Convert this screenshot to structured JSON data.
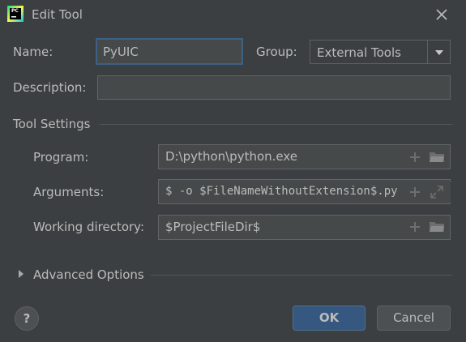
{
  "window": {
    "title": "Edit Tool",
    "logo_text": "PC"
  },
  "form": {
    "name_label": "Name:",
    "name_value": "PyUIC",
    "group_label": "Group:",
    "group_value": "External Tools",
    "description_label": "Description:",
    "description_value": ""
  },
  "tool_settings": {
    "section_label": "Tool Settings",
    "program_label": "Program:",
    "program_value": "D:\\python\\python.exe",
    "arguments_label": "Arguments:",
    "arguments_value": "$ -o $FileNameWithoutExtension$.py -x",
    "workdir_label": "Working directory:",
    "workdir_value": "$ProjectFileDir$"
  },
  "advanced": {
    "label": "Advanced Options"
  },
  "footer": {
    "help_label": "?",
    "ok_label": "OK",
    "cancel_label": "Cancel"
  },
  "icons": {
    "app": "pycharm-logo-icon",
    "close": "close-icon",
    "add": "plus-icon",
    "folder": "folder-icon",
    "expand": "expand-icon",
    "dropdown": "chevron-down-icon",
    "collapse": "triangle-right-icon"
  },
  "colors": {
    "background": "#3c3f41",
    "field": "#45494a",
    "focus": "#3d6185",
    "ok_button": "#365880",
    "text": "#bbbbbb"
  }
}
